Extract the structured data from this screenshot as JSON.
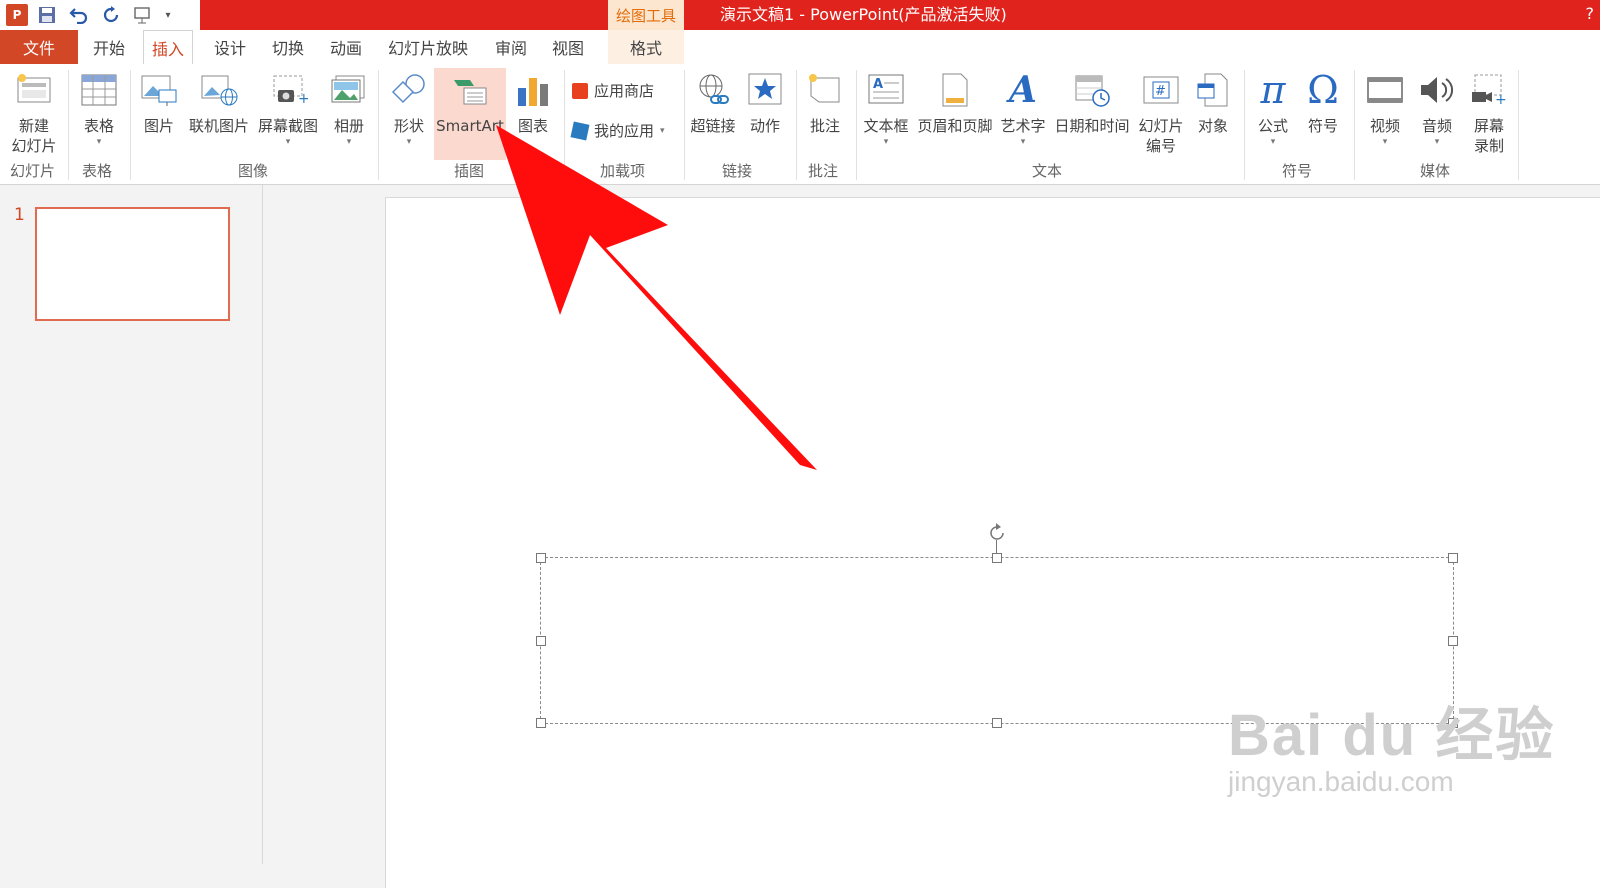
{
  "window": {
    "title": "演示文稿1 - PowerPoint(产品激活失败)",
    "context_tab": "绘图工具",
    "help": "?"
  },
  "qat": {
    "logo": "P",
    "icons": [
      "save-icon",
      "undo-icon",
      "redo-icon",
      "slideshow-icon",
      "customize-icon"
    ]
  },
  "tabs": {
    "file": "文件",
    "items": [
      "开始",
      "插入",
      "设计",
      "切换",
      "动画",
      "幻灯片放映",
      "审阅",
      "视图",
      "格式"
    ],
    "active": "插入"
  },
  "ribbon": {
    "new_slide": "新建\n幻灯片",
    "new_slide_l1": "新建",
    "new_slide_l2": "幻灯片",
    "table": "表格",
    "picture": "图片",
    "online_picture": "联机图片",
    "screenshot": "屏幕截图",
    "album": "相册",
    "shape": "形状",
    "smartart": "SmartArt",
    "chart": "图表",
    "app_store": "应用商店",
    "my_apps": "我的应用",
    "hyperlink": "超链接",
    "action": "动作",
    "comment": "批注",
    "textbox": "文本框",
    "header_footer": "页眉和页脚",
    "wordart": "艺术字",
    "datetime": "日期和时间",
    "slide_number_l1": "幻灯片",
    "slide_number_l2": "编号",
    "object": "对象",
    "equation": "公式",
    "symbol": "符号",
    "video": "视频",
    "audio": "音频",
    "screen_rec_l1": "屏幕",
    "screen_rec_l2": "录制",
    "groups": {
      "slides": "幻灯片",
      "tables": "表格",
      "images": "图像",
      "illustrations": "插图",
      "addins": "加载项",
      "links": "链接",
      "comments": "批注",
      "text": "文本",
      "symbols": "符号",
      "media": "媒体"
    }
  },
  "thumbnails": {
    "slide_number": "1"
  },
  "watermark": {
    "main": "Bai du 经验",
    "sub": "jingyan.baidu.com"
  },
  "colors": {
    "accent": "#d24726",
    "title_bar": "#e0231c",
    "arrow": "#ff0d0d"
  }
}
